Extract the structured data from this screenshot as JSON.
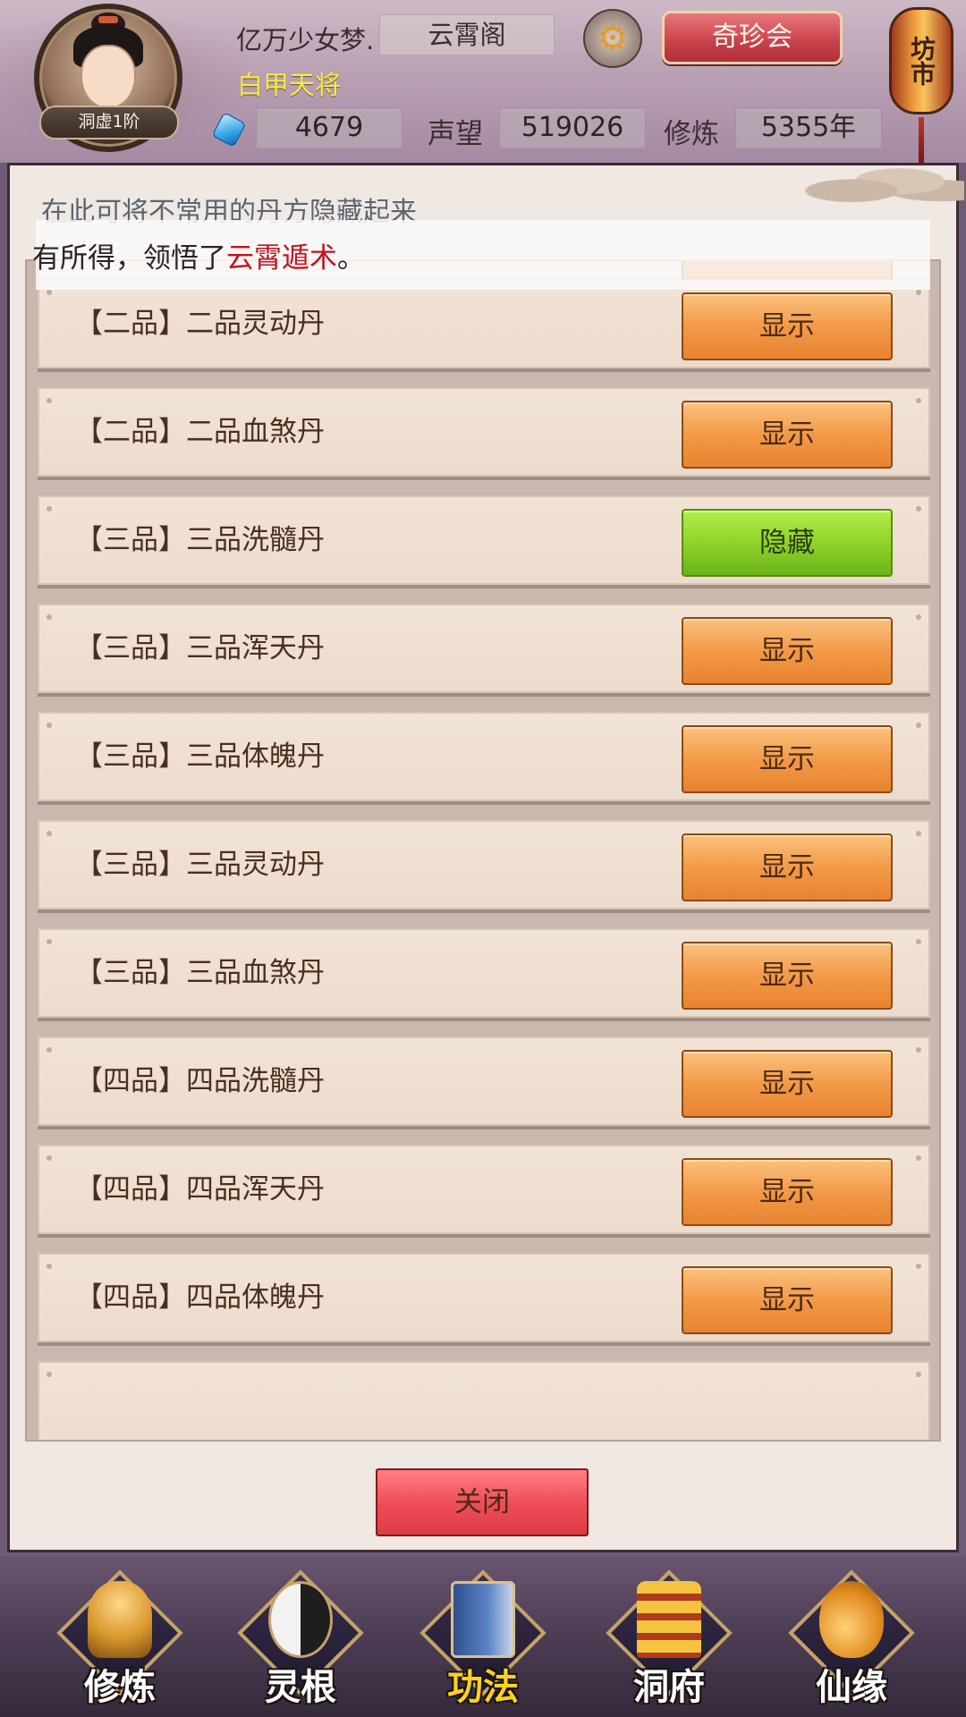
{
  "header": {
    "player_name": "亿万少女梦.",
    "guild": "云霄阁",
    "title": "白甲天将",
    "rank": "洞虚1阶",
    "gems": "4679",
    "reputation_label": "声望",
    "reputation_value": "519026",
    "cultivation_label": "修炼",
    "cultivation_value": "5355年",
    "settings_icon": "gear-icon",
    "shop_button": "奇珍会",
    "market_label": "坊市"
  },
  "panel": {
    "hint": "在此可将不常用的丹方隐藏起来",
    "toast": {
      "prefix": "有所得，领悟了",
      "highlight": "云霄遁术",
      "suffix": "。"
    },
    "rows": [
      {
        "label": "【二品】二品灵动丹",
        "button": "显示",
        "state": "show"
      },
      {
        "label": "【二品】二品血煞丹",
        "button": "显示",
        "state": "show"
      },
      {
        "label": "【三品】三品洗髓丹",
        "button": "隐藏",
        "state": "hide"
      },
      {
        "label": "【三品】三品浑天丹",
        "button": "显示",
        "state": "show"
      },
      {
        "label": "【三品】三品体魄丹",
        "button": "显示",
        "state": "show"
      },
      {
        "label": "【三品】三品灵动丹",
        "button": "显示",
        "state": "show"
      },
      {
        "label": "【三品】三品血煞丹",
        "button": "显示",
        "state": "show"
      },
      {
        "label": "【四品】四品洗髓丹",
        "button": "显示",
        "state": "show"
      },
      {
        "label": "【四品】四品浑天丹",
        "button": "显示",
        "state": "show"
      },
      {
        "label": "【四品】四品体魄丹",
        "button": "显示",
        "state": "show"
      }
    ],
    "close_button": "关闭"
  },
  "bottom_nav": [
    {
      "label": "修炼",
      "icon": "meditating-figure-icon",
      "active": false
    },
    {
      "label": "灵根",
      "icon": "yin-yang-sword-icon",
      "active": false
    },
    {
      "label": "功法",
      "icon": "scroll-book-icon",
      "active": true
    },
    {
      "label": "洞府",
      "icon": "pagoda-icon",
      "active": false
    },
    {
      "label": "仙缘",
      "icon": "gourd-icon",
      "active": false
    }
  ],
  "colors": {
    "show_button": "#f29a48",
    "hide_button": "#8fd32a",
    "close_button": "#ef4f58",
    "highlight_text": "#c0141e",
    "title_text": "#f6ee3f"
  }
}
